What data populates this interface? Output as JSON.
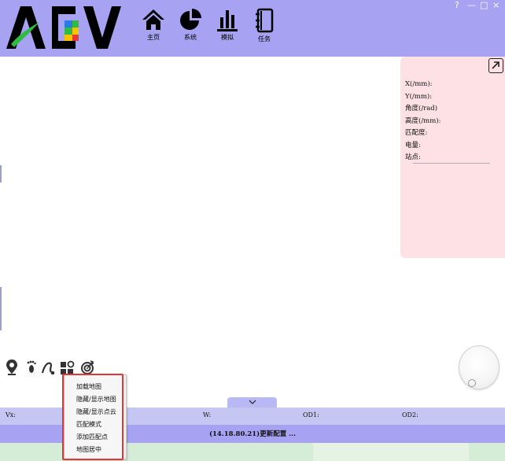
{
  "app": {
    "logo_text": "AGV",
    "window_controls": [
      "?",
      "—",
      "□",
      "×"
    ]
  },
  "nav": [
    {
      "label": "主页",
      "icon": "home-icon"
    },
    {
      "label": "系统",
      "icon": "pie-chart-icon"
    },
    {
      "label": "模拟",
      "icon": "bar-chart-icon"
    },
    {
      "label": "任务",
      "icon": "notebook-icon"
    }
  ],
  "info_panel": {
    "lines": [
      "X(/mm):",
      "Y(/mm):",
      "角度(/rad)",
      "高度(/mm):",
      "匹配度:",
      "电量:",
      "站点:"
    ],
    "expand_icon": "expand-arrow-icon"
  },
  "tools": [
    "location-pin-icon",
    "footprint-icon",
    "path-icon",
    "nodes-icon",
    "target-icon"
  ],
  "status": {
    "vx_label": "Vx:",
    "w_label": "W:",
    "od1_label": "OD1:",
    "od2_label": "OD2:"
  },
  "message": "(14.18.80.21)更新配置 ...",
  "context_menu": {
    "items": [
      "加载地图",
      "隐藏/显示地图",
      "隐藏/显示点云",
      "匹配模式",
      "添加匹配点",
      "地图居中"
    ]
  },
  "colors": {
    "header": "#a7a3f2",
    "info_panel": "#fde1e4",
    "velocity_bar": "#c5c6f2",
    "highlight": "#e03636",
    "logo_green": "#2dbb43",
    "logo_red": "#e63b2e",
    "logo_blue": "#2c7be5",
    "logo_yellow": "#f5c400"
  }
}
